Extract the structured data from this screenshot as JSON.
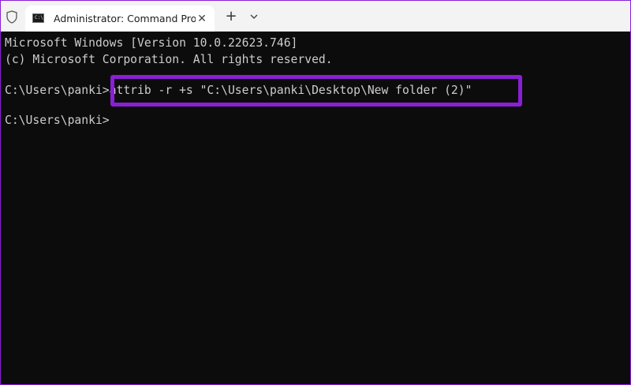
{
  "tab": {
    "title": "Administrator: Command Pro",
    "icon_glyph": "C:\\",
    "close_label": "✕"
  },
  "toolbar": {
    "new_tab_label": "+",
    "dropdown_icon": "chevron-down-icon",
    "shield_icon": "shield-icon"
  },
  "terminal": {
    "lines": [
      "Microsoft Windows [Version 10.0.22623.746]",
      "(c) Microsoft Corporation. All rights reserved.",
      "",
      "C:\\Users\\panki>attrib -r +s \"C:\\Users\\panki\\Desktop\\New folder (2)\"",
      "",
      "C:\\Users\\panki>"
    ]
  },
  "colors": {
    "highlight": "#8a1fd6",
    "terminal_bg": "#0c0c0c",
    "terminal_fg": "#cccccc"
  }
}
